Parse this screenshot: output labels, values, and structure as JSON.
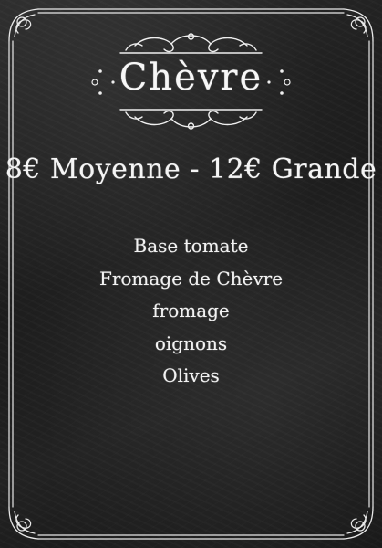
{
  "menu": {
    "title": "Chèvre",
    "price_line": "8€ Moyenne - 12€ Grande",
    "ingredients": [
      "Base tomate",
      "Fromage de Chèvre",
      "fromage",
      "oignons",
      "Olives"
    ]
  },
  "colors": {
    "board": "#1c1c1c",
    "chalk": "#f4f4f4"
  }
}
